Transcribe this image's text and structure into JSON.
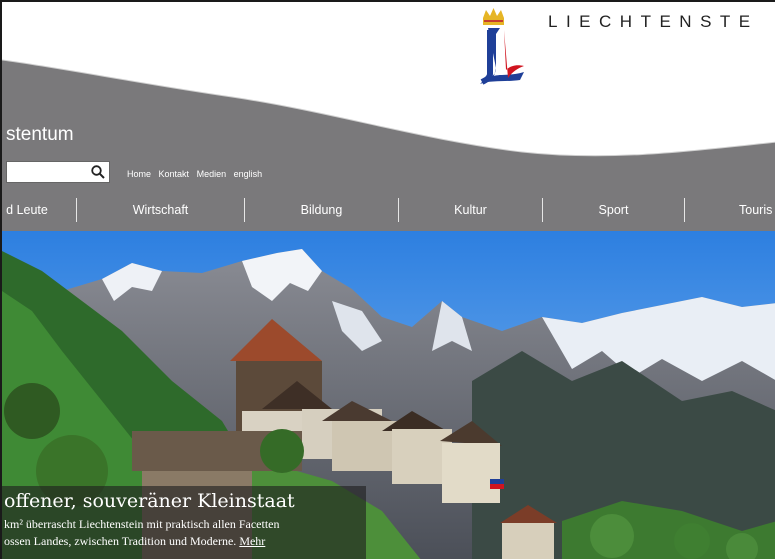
{
  "header": {
    "brand_text": "LIECHTENSTE",
    "site_title": "stentum",
    "search": {
      "value": "",
      "placeholder": ""
    },
    "top_links": [
      "Home",
      "Kontakt",
      "Medien",
      "english"
    ]
  },
  "nav": {
    "items": [
      "d Leute",
      "Wirtschaft",
      "Bildung",
      "Kultur",
      "Sport",
      "Touris"
    ]
  },
  "hero": {
    "caption_title": "offener, souveräner Kleinstaat",
    "caption_line1": "km² überrascht Liechtenstein mit praktisch allen Facetten",
    "caption_line2": "ossen Landes, zwischen Tradition und Moderne.",
    "more_label": "Mehr"
  },
  "colors": {
    "header_gray": "#7a797b",
    "logo_blue": "#1f3f98",
    "logo_red": "#d0141f",
    "crown_gold": "#e6b525",
    "sky_blue": "#3f8ee8"
  },
  "icons": [
    "search-icon",
    "crown-icon"
  ]
}
